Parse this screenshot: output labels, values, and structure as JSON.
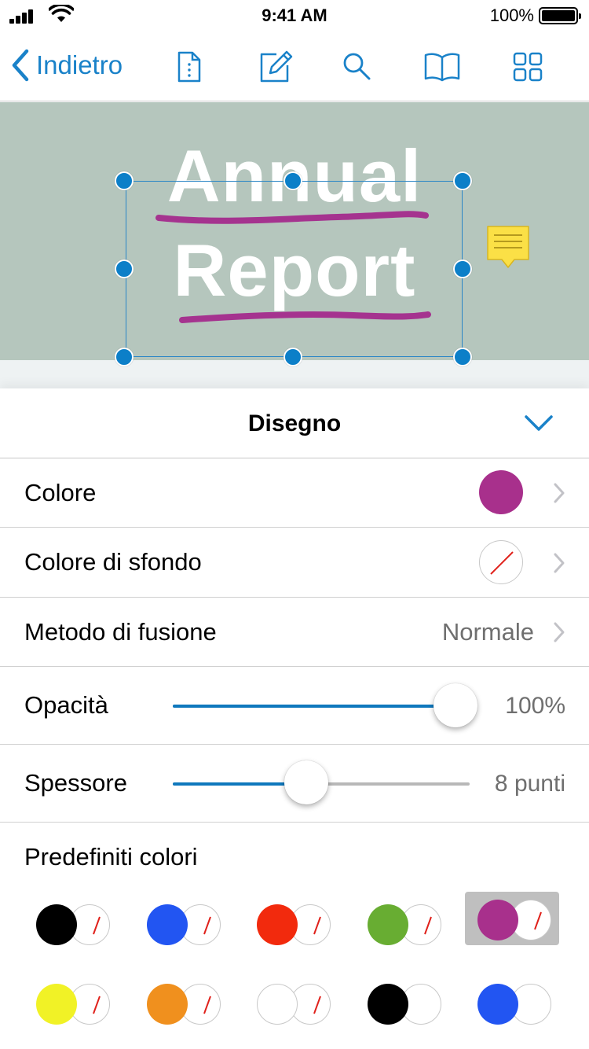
{
  "status_bar": {
    "time": "9:41 AM",
    "battery": "100%"
  },
  "nav": {
    "back_label": "Indietro",
    "icons": [
      "document-info-icon",
      "edit-icon",
      "search-icon",
      "book-icon",
      "grid-icon"
    ],
    "accent": "#1a82c9"
  },
  "document": {
    "line1": "Annual",
    "line2": "Report",
    "banner_color": "#b5c6bd",
    "ink_color": "#a5338f"
  },
  "panel": {
    "title": "Disegno",
    "rows": {
      "color": {
        "label": "Colore",
        "value_color": "#a8308c"
      },
      "background": {
        "label": "Colore di sfondo",
        "value": "none"
      },
      "blend": {
        "label": "Metodo di fusione",
        "value": "Normale"
      },
      "opacity": {
        "label": "Opacità",
        "value": "100%",
        "level": 1.0
      },
      "thickness": {
        "label": "Spessore",
        "value": "8 punti",
        "level": 0.45
      }
    },
    "presets_label": "Predefiniti colori",
    "presets": [
      {
        "fg": "#000000",
        "bg": "none",
        "selected": false
      },
      {
        "fg": "#2255f2",
        "bg": "none",
        "selected": false
      },
      {
        "fg": "#f22a0d",
        "bg": "none",
        "selected": false
      },
      {
        "fg": "#68ad32",
        "bg": "none",
        "selected": false
      },
      {
        "fg": "#a8308c",
        "bg": "none",
        "selected": true
      },
      {
        "fg": "#f1f226",
        "bg": "none",
        "selected": false
      },
      {
        "fg": "#f0901e",
        "bg": "none",
        "selected": false
      },
      {
        "fg": "#ffffff",
        "bg": "none",
        "selected": false
      },
      {
        "fg": "#000000",
        "bg": "#ffffff",
        "selected": false
      },
      {
        "fg": "#2255f2",
        "bg": "#ffffff",
        "selected": false
      }
    ]
  }
}
